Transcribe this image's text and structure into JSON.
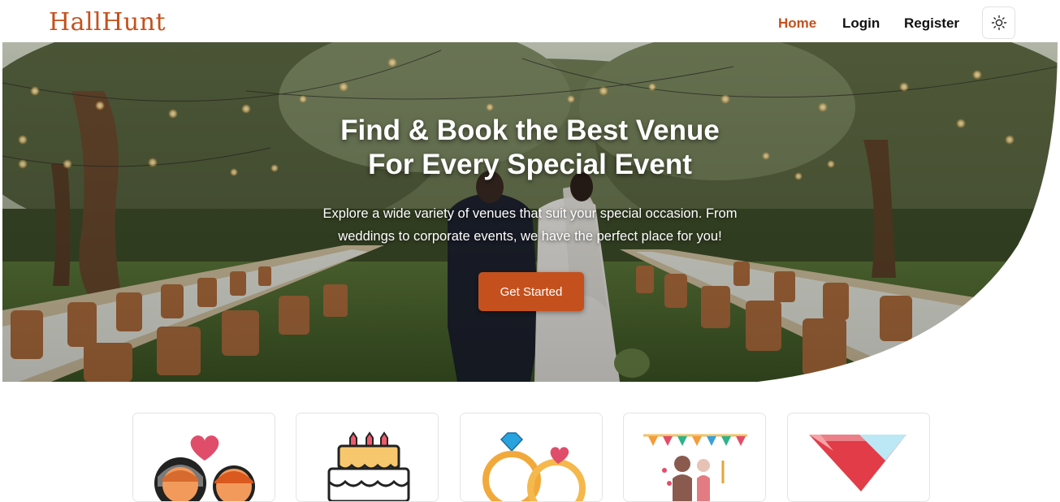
{
  "brand": {
    "logo": "HallHunt",
    "accent": "#c4511d"
  },
  "nav": {
    "items": [
      {
        "label": "Home",
        "active": true
      },
      {
        "label": "Login",
        "active": false
      },
      {
        "label": "Register",
        "active": false
      }
    ],
    "theme_toggle_icon": "sun-icon"
  },
  "hero": {
    "title_line1": "Find & Book the Best Venue",
    "title_line2": "For Every Special Event",
    "subtitle_line1": "Explore a wide variety of venues that suit your special occasion. From",
    "subtitle_line2": "weddings to corporate events, we have the perfect place for you!",
    "cta_label": "Get Started"
  },
  "categories": [
    {
      "icon": "couple-heart-icon"
    },
    {
      "icon": "cake-icon"
    },
    {
      "icon": "rings-icon"
    },
    {
      "icon": "party-bunting-icon"
    },
    {
      "icon": "cocktail-icon"
    }
  ]
}
